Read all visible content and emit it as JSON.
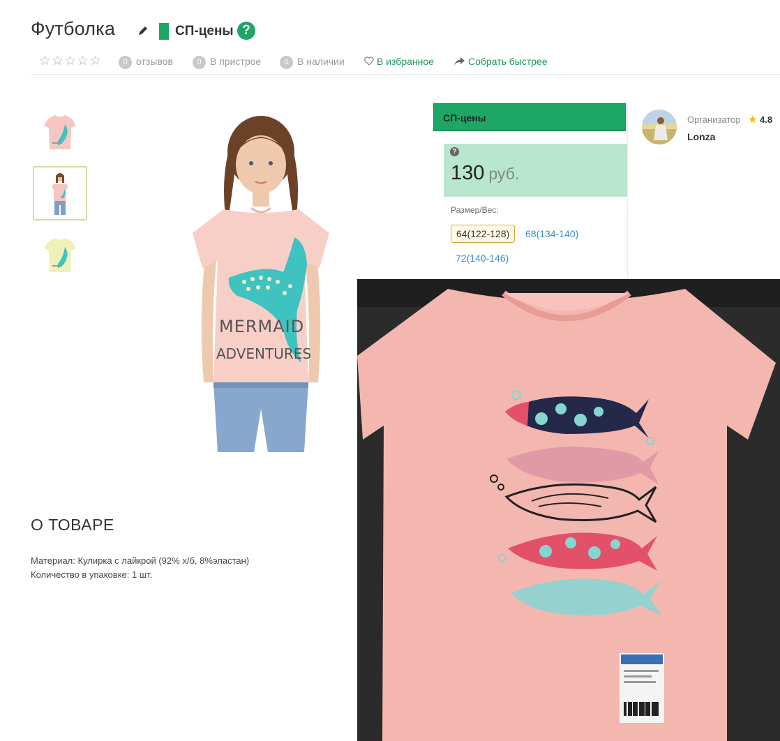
{
  "header": {
    "title": "Футболка",
    "badge_label": "СП-цены",
    "help": "?"
  },
  "meta_bar": {
    "stars": "☆☆☆☆☆",
    "reviews_count": "0",
    "reviews_label": "отзывов",
    "attach_count": "0",
    "attach_label": "В пристрое",
    "stock_count": "0",
    "stock_label": "В наличии",
    "favorite_label": "В избранное",
    "quick_label": "Собрать быстрее"
  },
  "price_card": {
    "heading": "СП-цены",
    "help": "?",
    "price": "130",
    "currency": "руб.",
    "size_label": "Размер/Вес:",
    "sizes": [
      "64(122-128)",
      "68(134-140)",
      "72(140-146)"
    ]
  },
  "organizer": {
    "label": "Организатор",
    "rating": "4.8",
    "name": "Lonza"
  },
  "about": {
    "title": "О ТОВАРЕ",
    "material": "Материал: Кулирка с лайкрой (92% х/б, 8%эластан)",
    "quantity": "Количество в упаковке: 1 шт."
  },
  "product_print": {
    "text_line1": "MERMAID",
    "text_line2": "ADVENTURES"
  },
  "colors": {
    "accent": "#1ea664",
    "price_bg": "#b8e6cf",
    "link": "#3a8fc8",
    "tshirt_pink": "#f6c7c2",
    "tshirt_yellow": "#f0f0b8",
    "mermaid_teal": "#3ec3c0"
  },
  "icons": [
    "edit-icon",
    "help-icon",
    "heart-icon",
    "share-arrow-icon",
    "star-icon"
  ]
}
